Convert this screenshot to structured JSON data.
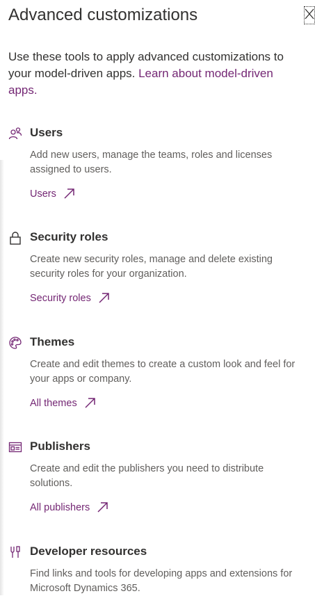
{
  "panel": {
    "title": "Advanced customizations",
    "close_icon": "close-icon",
    "intro_text": "Use these tools to apply advanced customizations to your model-driven apps. ",
    "intro_link": "Learn about model-driven apps."
  },
  "colors": {
    "accent": "#742774",
    "text": "#323130",
    "secondary_text": "#605e5c"
  },
  "sections": [
    {
      "icon": "users-icon",
      "title": "Users",
      "description": "Add new users, manage the teams, roles and licenses assigned to users.",
      "link": "Users"
    },
    {
      "icon": "lock-icon",
      "title": "Security roles",
      "description": "Create new security roles, manage and delete existing security roles for your organization.",
      "link": "Security roles"
    },
    {
      "icon": "palette-icon",
      "title": "Themes",
      "description": "Create and edit themes to create a custom look and feel for your apps or company.",
      "link": "All themes"
    },
    {
      "icon": "publisher-icon",
      "title": "Publishers",
      "description": "Create and edit the publishers you need to distribute solutions.",
      "link": "All publishers"
    },
    {
      "icon": "developer-tools-icon",
      "title": "Developer resources",
      "description": "Find links and tools for developing apps and extensions for Microsoft Dynamics 365.",
      "link": ""
    }
  ]
}
